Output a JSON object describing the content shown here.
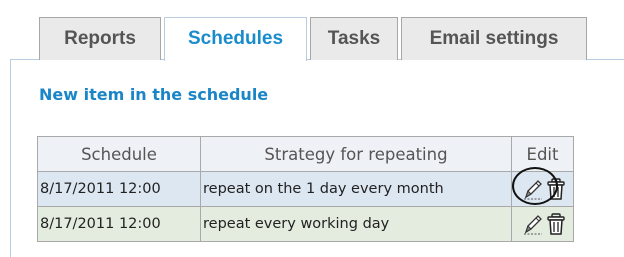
{
  "tabs": [
    {
      "label": "Reports",
      "active": false
    },
    {
      "label": "Schedules",
      "active": true
    },
    {
      "label": "Tasks",
      "active": false
    },
    {
      "label": "Email settings",
      "active": false
    }
  ],
  "new_item_link": "New item in the schedule",
  "table": {
    "headers": [
      "Schedule",
      "Strategy for repeating",
      "Edit"
    ],
    "rows": [
      {
        "schedule": "8/17/2011 12:00",
        "strategy": "repeat on the 1 day every month",
        "icons": [
          "pencil-icon",
          "trash-icon"
        ]
      },
      {
        "schedule": "8/17/2011 12:00",
        "strategy": "repeat every working day",
        "icons": [
          "pencil-icon",
          "trash-icon"
        ]
      }
    ]
  },
  "colors": {
    "accent": "#1a86c7",
    "row_1_bg": "#dde7f2",
    "row_2_bg": "#e3ecdf",
    "header_bg": "#eef1f6"
  }
}
